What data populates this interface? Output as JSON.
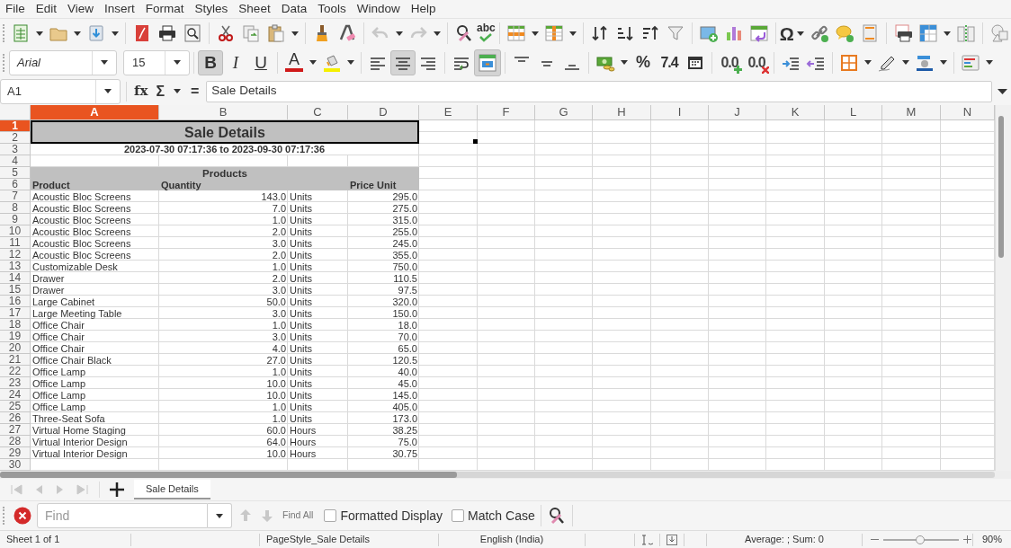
{
  "menu": [
    "File",
    "Edit",
    "View",
    "Insert",
    "Format",
    "Styles",
    "Sheet",
    "Data",
    "Tools",
    "Window",
    "Help"
  ],
  "standard_toolbar": {
    "undo_disabled": true,
    "redo_disabled": true,
    "spelling_label": "abc",
    "special_character_label": "Ω"
  },
  "formatting_toolbar": {
    "font_name": "Arial",
    "font_size": "15",
    "style_buttons": [
      {
        "kind": "bold",
        "label": "B",
        "pressed": true
      },
      {
        "kind": "italic",
        "label": "I",
        "pressed": false
      },
      {
        "kind": "underline",
        "label": "U",
        "pressed": false
      }
    ],
    "font_color_label": "A",
    "alignment": [
      {
        "kind": "left",
        "selected": false
      },
      {
        "kind": "center",
        "selected": true
      },
      {
        "kind": "right",
        "selected": false
      }
    ],
    "wrap_text_pressed": false,
    "merge_and_center_pressed": true,
    "percent_label": "%",
    "number_label": "7.4",
    "add_decimal_label": "0.0",
    "delete_decimal_label": "0.0"
  },
  "formula_bar": {
    "name_box": "A1",
    "function_wizard_label": "fx",
    "sum_label": "Σ",
    "formula_label": "=",
    "content": "Sale Details"
  },
  "sheet": {
    "columns": [
      {
        "label": "A",
        "selected": true
      },
      {
        "label": "B",
        "selected": false
      },
      {
        "label": "C",
        "selected": false
      },
      {
        "label": "D",
        "selected": false
      },
      {
        "label": "E",
        "selected": false
      },
      {
        "label": "F",
        "selected": false
      },
      {
        "label": "G",
        "selected": false
      },
      {
        "label": "H",
        "selected": false
      },
      {
        "label": "I",
        "selected": false
      },
      {
        "label": "J",
        "selected": false
      },
      {
        "label": "K",
        "selected": false
      },
      {
        "label": "L",
        "selected": false
      },
      {
        "label": "M",
        "selected": false
      },
      {
        "label": "N",
        "selected": false
      }
    ],
    "rows": [
      {
        "label": "1",
        "selected": true
      },
      {
        "label": "2",
        "selected": false
      },
      {
        "label": "3",
        "selected": false
      },
      {
        "label": "4",
        "selected": false
      },
      {
        "label": "5",
        "selected": false
      },
      {
        "label": "6",
        "selected": false
      },
      {
        "label": "7",
        "selected": false
      },
      {
        "label": "8",
        "selected": false
      },
      {
        "label": "9",
        "selected": false
      },
      {
        "label": "10",
        "selected": false
      },
      {
        "label": "11",
        "selected": false
      },
      {
        "label": "12",
        "selected": false
      },
      {
        "label": "13",
        "selected": false
      },
      {
        "label": "14",
        "selected": false
      },
      {
        "label": "15",
        "selected": false
      },
      {
        "label": "16",
        "selected": false
      },
      {
        "label": "17",
        "selected": false
      },
      {
        "label": "18",
        "selected": false
      },
      {
        "label": "19",
        "selected": false
      },
      {
        "label": "20",
        "selected": false
      },
      {
        "label": "21",
        "selected": false
      },
      {
        "label": "22",
        "selected": false
      },
      {
        "label": "23",
        "selected": false
      },
      {
        "label": "24",
        "selected": false
      },
      {
        "label": "25",
        "selected": false
      },
      {
        "label": "26",
        "selected": false
      },
      {
        "label": "27",
        "selected": false
      },
      {
        "label": "28",
        "selected": false
      },
      {
        "label": "29",
        "selected": false
      },
      {
        "label": "30",
        "selected": false
      }
    ],
    "title": "Sale Details",
    "date_range": "2023-07-30 07:17:36 to 2023-09-30 07:17:36",
    "group_header": "Products",
    "headers": [
      "Product",
      "Quantity",
      "Price Unit"
    ],
    "records": [
      {
        "product": "Acoustic Bloc Screens",
        "quantity": "143.0",
        "unit": "Units",
        "price": "295.0"
      },
      {
        "product": "Acoustic Bloc Screens",
        "quantity": "7.0",
        "unit": "Units",
        "price": "275.0"
      },
      {
        "product": "Acoustic Bloc Screens",
        "quantity": "1.0",
        "unit": "Units",
        "price": "315.0"
      },
      {
        "product": "Acoustic Bloc Screens",
        "quantity": "2.0",
        "unit": "Units",
        "price": "255.0"
      },
      {
        "product": "Acoustic Bloc Screens",
        "quantity": "3.0",
        "unit": "Units",
        "price": "245.0"
      },
      {
        "product": "Acoustic Bloc Screens",
        "quantity": "2.0",
        "unit": "Units",
        "price": "355.0"
      },
      {
        "product": "Customizable Desk",
        "quantity": "1.0",
        "unit": "Units",
        "price": "750.0"
      },
      {
        "product": "Drawer",
        "quantity": "2.0",
        "unit": "Units",
        "price": "110.5"
      },
      {
        "product": "Drawer",
        "quantity": "3.0",
        "unit": "Units",
        "price": "97.5"
      },
      {
        "product": "Large Cabinet",
        "quantity": "50.0",
        "unit": "Units",
        "price": "320.0"
      },
      {
        "product": "Large Meeting Table",
        "quantity": "3.0",
        "unit": "Units",
        "price": "150.0"
      },
      {
        "product": "Office Chair",
        "quantity": "1.0",
        "unit": "Units",
        "price": "18.0"
      },
      {
        "product": "Office Chair",
        "quantity": "3.0",
        "unit": "Units",
        "price": "70.0"
      },
      {
        "product": "Office Chair",
        "quantity": "4.0",
        "unit": "Units",
        "price": "65.0"
      },
      {
        "product": "Office Chair Black",
        "quantity": "27.0",
        "unit": "Units",
        "price": "120.5"
      },
      {
        "product": "Office Lamp",
        "quantity": "1.0",
        "unit": "Units",
        "price": "40.0"
      },
      {
        "product": "Office Lamp",
        "quantity": "10.0",
        "unit": "Units",
        "price": "45.0"
      },
      {
        "product": "Office Lamp",
        "quantity": "10.0",
        "unit": "Units",
        "price": "145.0"
      },
      {
        "product": "Office Lamp",
        "quantity": "1.0",
        "unit": "Units",
        "price": "405.0"
      },
      {
        "product": "Three-Seat Sofa",
        "quantity": "1.0",
        "unit": "Units",
        "price": "173.0"
      },
      {
        "product": "Virtual Home Staging",
        "quantity": "60.0",
        "unit": "Hours",
        "price": "38.25"
      },
      {
        "product": "Virtual Interior Design",
        "quantity": "64.0",
        "unit": "Hours",
        "price": "75.0"
      },
      {
        "product": "Virtual Interior Design",
        "quantity": "10.0",
        "unit": "Hours",
        "price": "30.75"
      }
    ]
  },
  "sheet_tabs": [
    {
      "label": "Sale Details",
      "selected": true
    }
  ],
  "find_toolbar": {
    "placeholder": "Find",
    "find_all": "Find All",
    "options": [
      {
        "label": "Formatted Display",
        "checked": false
      },
      {
        "label": "Match Case",
        "checked": false
      }
    ]
  },
  "status_bar": {
    "sheet": "Sheet 1 of 1",
    "page_style": "PageStyle_Sale Details",
    "language": "English (India)",
    "selection_summary": "Average: ; Sum: 0",
    "zoom_slider": {
      "level": 0.49
    },
    "zoom": "90%"
  }
}
